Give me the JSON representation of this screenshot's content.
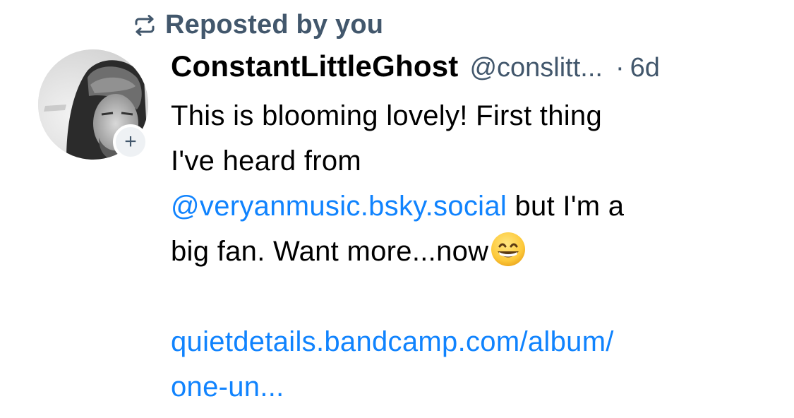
{
  "repost": {
    "label": "Reposted by you",
    "icon": "repost-icon",
    "color": "#42576c"
  },
  "author": {
    "display_name": "ConstantLittleGhost",
    "handle": "@conslitt...",
    "separator": "·",
    "time": "6d",
    "avatar_icon": "avatar-photo",
    "follow_icon": "plus-icon",
    "follow_label": "+"
  },
  "post": {
    "line1": "This is blooming lovely! First thing",
    "line2": "I've heard from",
    "mention": "@veryanmusic.bsky.social",
    "line3_rest": " but I'm a",
    "line4": "big fan. Want more...now",
    "emoji": "grinning-face-emoji",
    "link_line1": "quietdetails.bandcamp.com/album/",
    "link_line2": "one-un..."
  },
  "colors": {
    "text": "#000000",
    "muted": "#42576c",
    "link": "#1083fe",
    "background": "#ffffff"
  }
}
